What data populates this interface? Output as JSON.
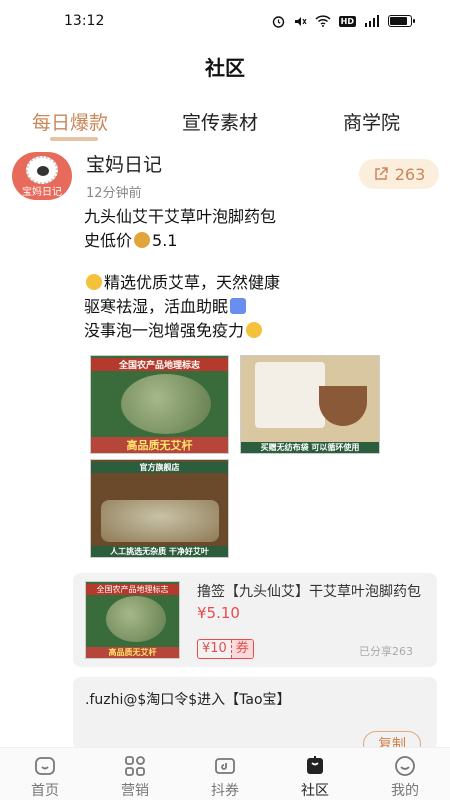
{
  "status": {
    "time": "13:12",
    "hd": "HD",
    "battery_level": 0.85
  },
  "header": {
    "title": "社区"
  },
  "tabs": [
    {
      "label": "每日爆款",
      "active": true
    },
    {
      "label": "宣传素材",
      "active": false
    },
    {
      "label": "商学院",
      "active": false
    }
  ],
  "post": {
    "avatar_text": "宝妈日记",
    "author": "宝妈日记",
    "time": "12分钟前",
    "share_count": "263",
    "lines": [
      "九头仙艾干艾草叶泡脚药包",
      "史低价",
      "5.1",
      "精选优质艾草，天然健康",
      "驱寒祛湿，活血助眠",
      "没事泡一泡增强免疫力"
    ],
    "images": [
      {
        "top_text": "全国农产品地理标志",
        "bottom_text": "高品质无艾杆"
      },
      {
        "bottom_text": "买赠无纺布袋 可以循环使用"
      },
      {
        "top_text": "官方旗舰店",
        "bottom_text": "人工挑选无杂质 干净好艾叶"
      }
    ]
  },
  "product": {
    "name": "撸签【九头仙艾】干艾草叶泡脚药包",
    "price": "¥5.10",
    "coupon_amount": "¥10",
    "coupon_tag": "券",
    "shared": "已分享263",
    "thumb_top": "全国农产品地理标志",
    "thumb_bottom": "高品质无艾杆"
  },
  "copy_card": {
    "text": ".fuzhi@$淘口令$进入【Tao宝】",
    "button": "复制"
  },
  "bottom_nav": [
    {
      "label": "首页",
      "icon": "home-icon",
      "active": false
    },
    {
      "label": "营销",
      "icon": "grid-icon",
      "active": false
    },
    {
      "label": "抖券",
      "icon": "ticket-icon",
      "active": false
    },
    {
      "label": "社区",
      "icon": "community-icon",
      "active": true
    },
    {
      "label": "我的",
      "icon": "profile-icon",
      "active": false
    }
  ],
  "colors": {
    "accent": "#c9875a",
    "price_red": "#e94c4c",
    "share_bg": "#fbeedd"
  }
}
